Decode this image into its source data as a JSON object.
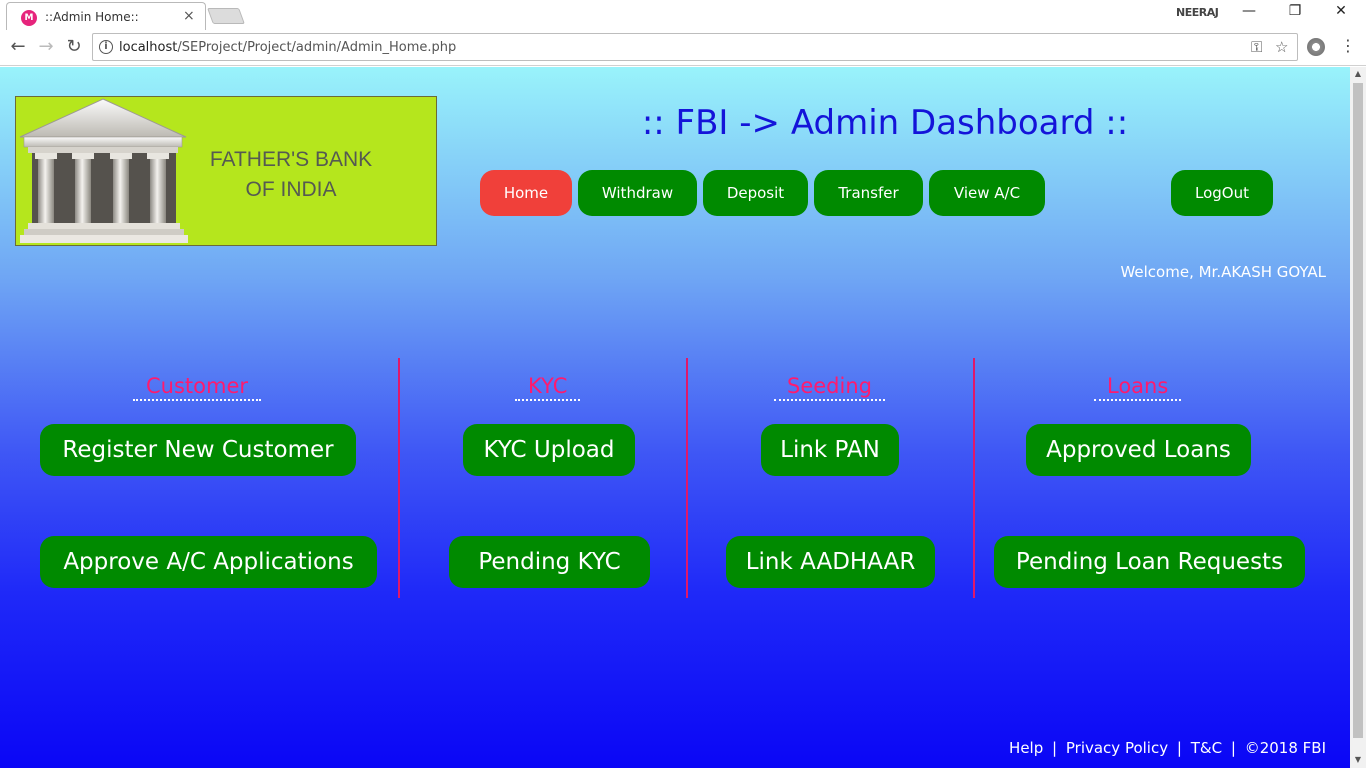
{
  "browser": {
    "tab_title": "::Admin Home::",
    "tab_close": "×",
    "profile_name": "NEERAJ",
    "url_host": "localhost",
    "url_path": "/SEProject/Project/admin/Admin_Home.php"
  },
  "header": {
    "logo_line1": "FATHER'S BANK",
    "logo_line2": "OF INDIA",
    "title": ":: FBI -> Admin Dashboard ::"
  },
  "nav": {
    "home": "Home",
    "withdraw": "Withdraw",
    "deposit": "Deposit",
    "transfer": "Transfer",
    "view_ac": "View A/C",
    "logout": "LogOut"
  },
  "welcome": "Welcome, Mr.AKASH GOYAL",
  "sections": {
    "customer": {
      "title": "Customer",
      "btn1": "Register New Customer",
      "btn2": "Approve A/C Applications"
    },
    "kyc": {
      "title": "KYC",
      "btn1": "KYC Upload",
      "btn2": "Pending KYC"
    },
    "seeding": {
      "title": "Seeding",
      "btn1": "Link PAN",
      "btn2": "Link AADHAAR"
    },
    "loans": {
      "title": "Loans",
      "btn1": "Approved Loans",
      "btn2": "Pending Loan Requests"
    }
  },
  "footer": {
    "help": "Help",
    "sep": "|",
    "privacy": "Privacy Policy",
    "tnc": "T&C",
    "copyright": "©2018 FBI"
  },
  "colors": {
    "button_green": "#008a00",
    "active_red": "#f0403a",
    "title_blue": "#1414d9",
    "section_pink": "#ff1a6e"
  }
}
